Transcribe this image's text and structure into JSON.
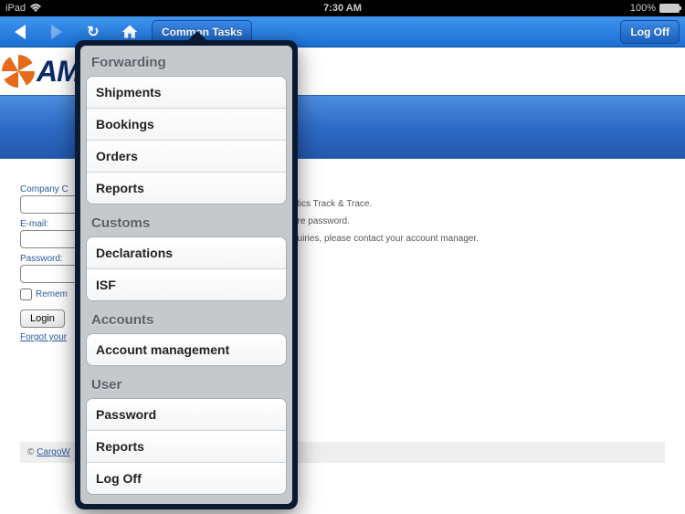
{
  "status": {
    "device": "iPad",
    "time": "7:30 AM",
    "battery": "100%"
  },
  "nav": {
    "common_tasks": "Common Tasks",
    "log_off": "Log Off"
  },
  "logo": {
    "text": "AM"
  },
  "login": {
    "company_label": "Company C",
    "email_label": "E-mail:",
    "password_label": "Password:",
    "remember_label": "Remem",
    "button": "Login",
    "forgot": "Forgot your"
  },
  "welcome": {
    "line1": "stics Track & Trace.",
    "line2": "ure password.",
    "line3": "quiries, please contact your account manager."
  },
  "footer": {
    "copy": "© ",
    "link": "CargoW"
  },
  "menu": {
    "sections": [
      {
        "title": "Forwarding",
        "items": [
          "Shipments",
          "Bookings",
          "Orders",
          "Reports"
        ]
      },
      {
        "title": "Customs",
        "items": [
          "Declarations",
          "ISF"
        ]
      },
      {
        "title": "Accounts",
        "items": [
          "Account management"
        ]
      },
      {
        "title": "User",
        "items": [
          "Password",
          "Reports",
          "Log Off"
        ]
      }
    ]
  }
}
